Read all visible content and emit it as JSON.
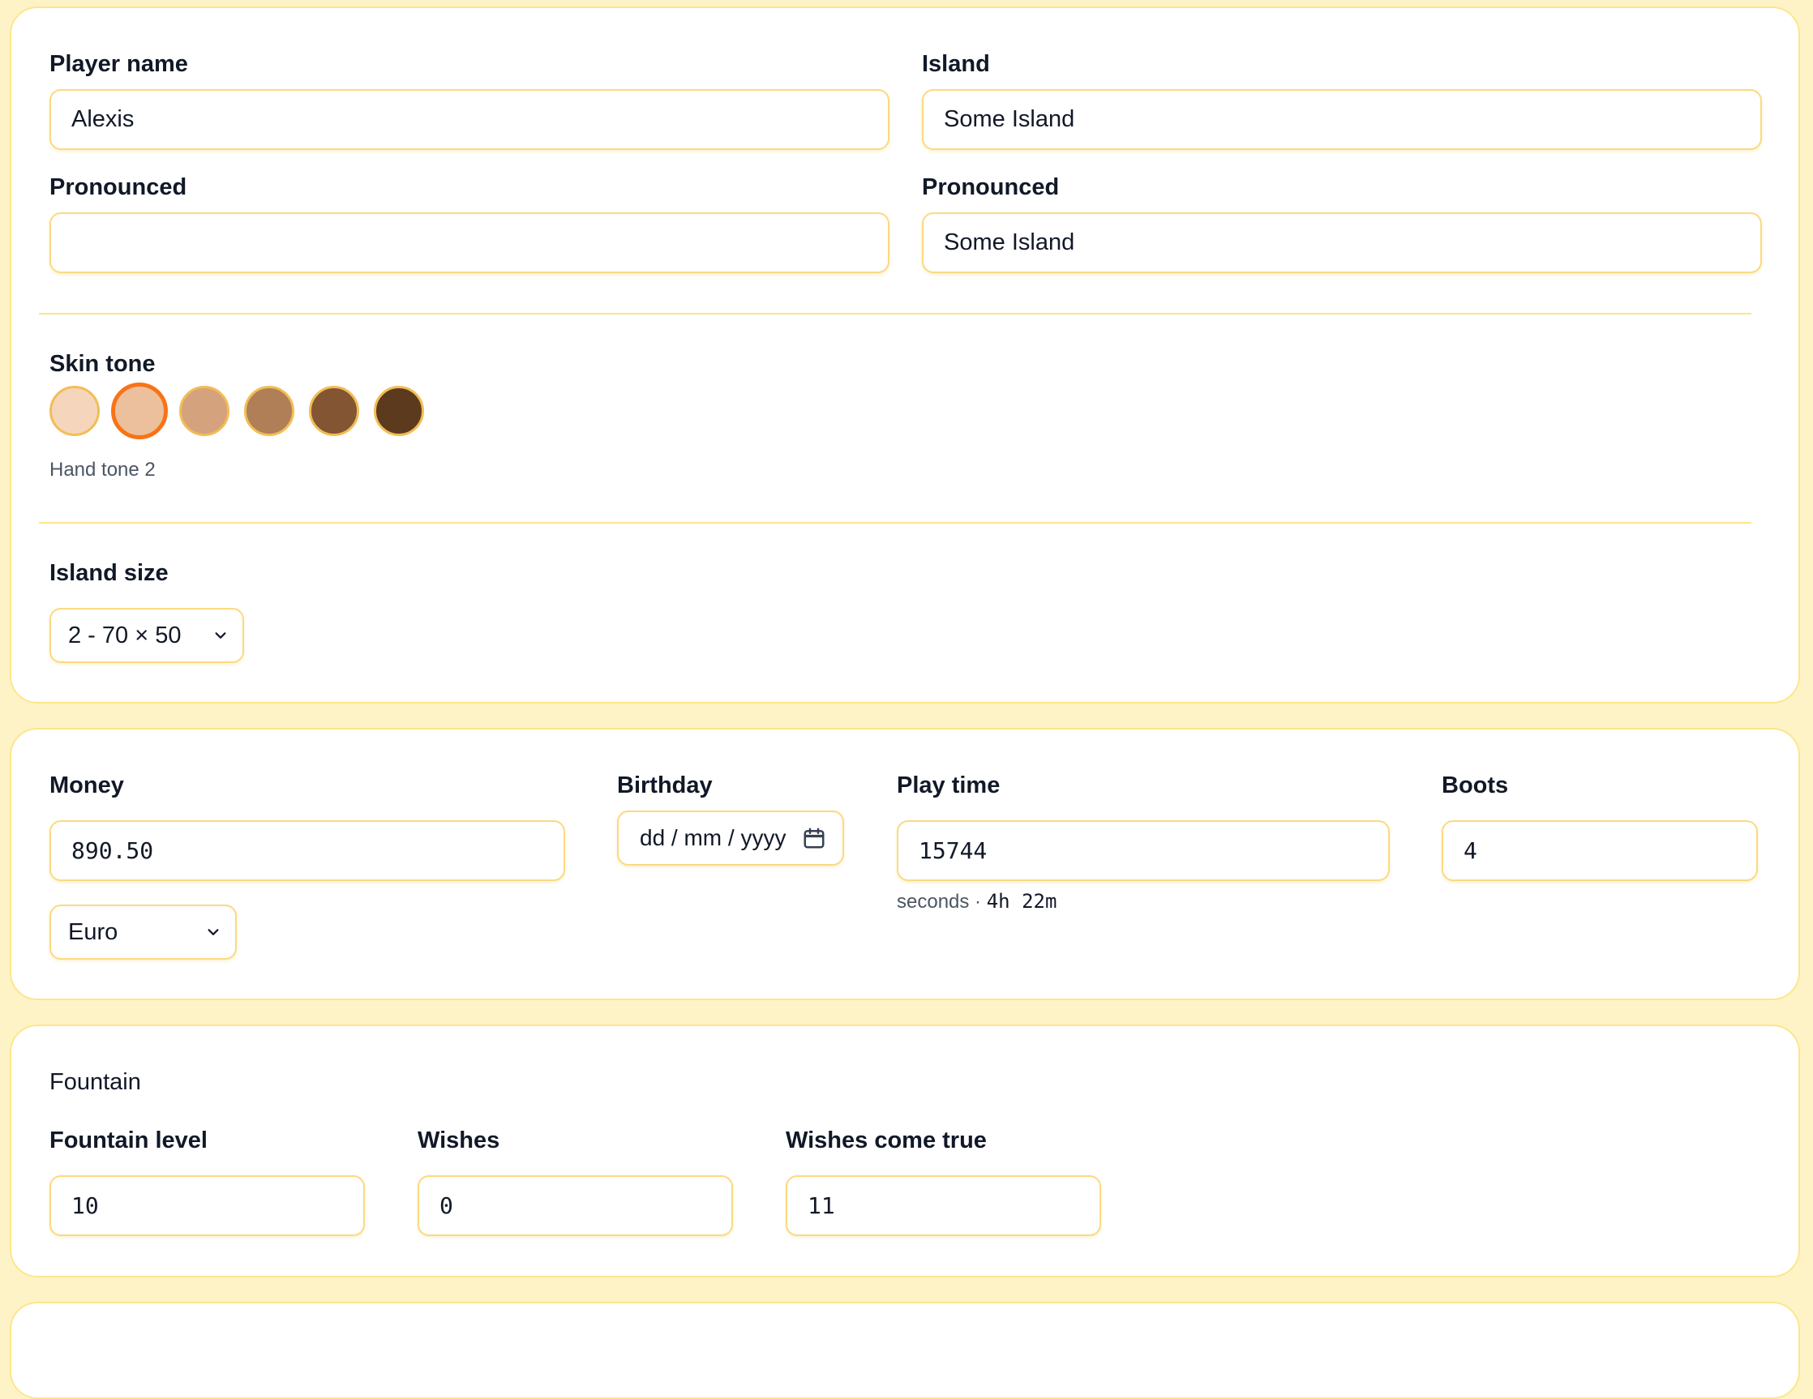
{
  "profile": {
    "player_name_label": "Player name",
    "player_name_value": "Alexis",
    "island_label": "Island",
    "island_value": "Some Island",
    "player_pronounced_label": "Pronounced",
    "player_pronounced_value": "",
    "island_pronounced_label": "Pronounced",
    "island_pronounced_value": "Some Island",
    "skin_tone_label": "Skin tone",
    "skin_tones": [
      {
        "color": "#f5d6bc"
      },
      {
        "color": "#ecc09c"
      },
      {
        "color": "#d4a27c"
      },
      {
        "color": "#b07e57"
      },
      {
        "color": "#845533"
      },
      {
        "color": "#5c3a1d"
      }
    ],
    "skin_tone_selected_index": 1,
    "skin_tone_caption": "Hand tone 2",
    "island_size_label": "Island size",
    "island_size_value": "2 - 70 × 50"
  },
  "stats": {
    "money_label": "Money",
    "money_value": "890.50",
    "currency_value": "Euro",
    "birthday_label": "Birthday",
    "birthday_placeholder": "dd / mm / yyyy",
    "play_time_label": "Play time",
    "play_time_value": "15744",
    "play_time_hint_prefix": "seconds · ",
    "play_time_hint_duration": "4h 22m",
    "boots_label": "Boots",
    "boots_value": "4"
  },
  "fountain": {
    "section_title": "Fountain",
    "level_label": "Fountain level",
    "level_value": "10",
    "wishes_label": "Wishes",
    "wishes_value": "0",
    "wishes_true_label": "Wishes come true",
    "wishes_true_value": "11"
  },
  "colors": {
    "background": "#fef3c7",
    "border": "#fde68a",
    "accent_selected": "#f97316"
  }
}
